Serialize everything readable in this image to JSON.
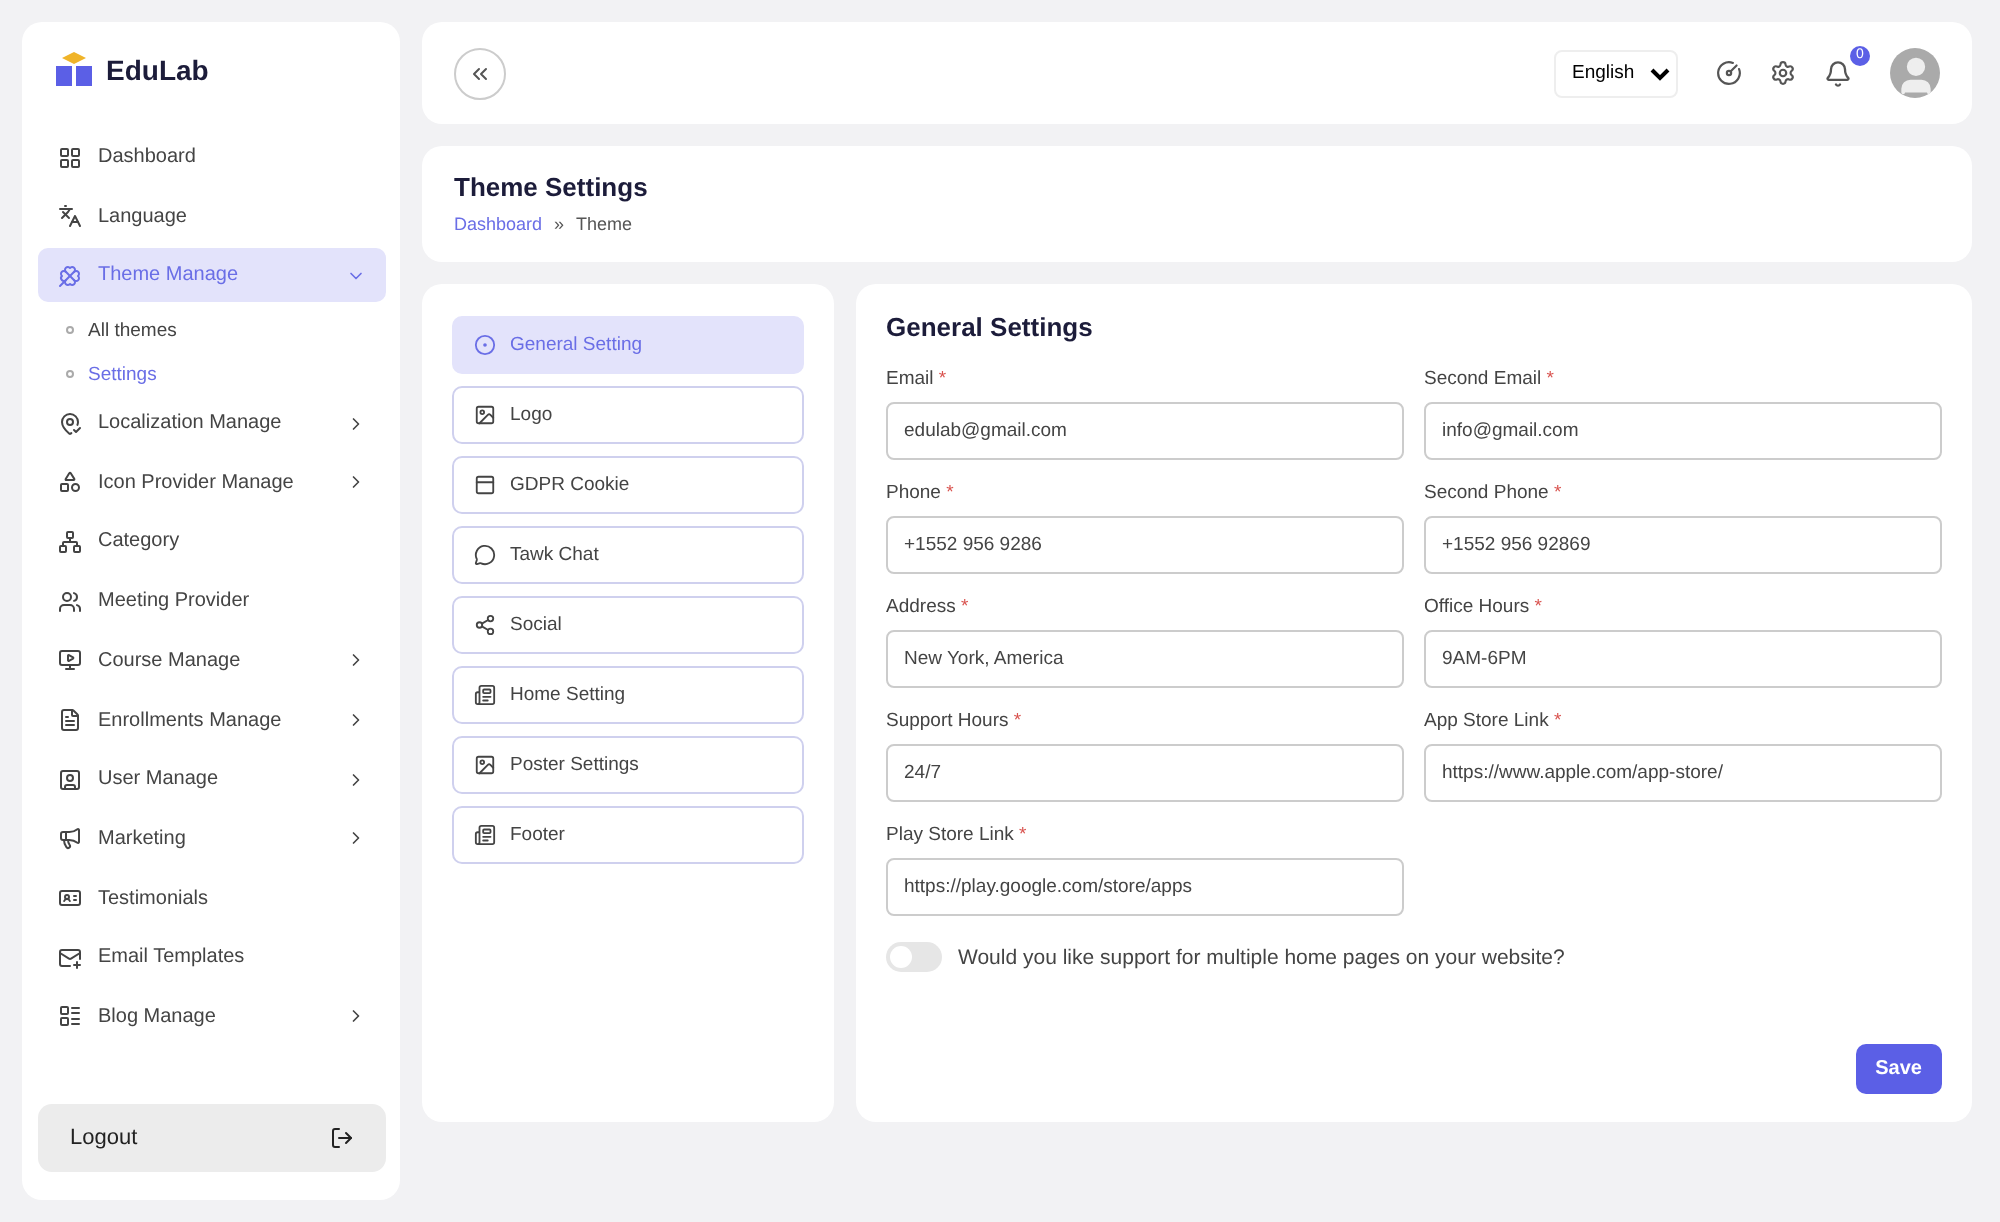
{
  "brand": {
    "name": "EduLab"
  },
  "sidebar": {
    "items": [
      {
        "label": "Dashboard",
        "kind": "link",
        "selected": false
      },
      {
        "label": "Language",
        "kind": "link",
        "selected": false
      },
      {
        "label": "Theme Manage",
        "kind": "group",
        "selected": true,
        "expanded": true,
        "children": [
          {
            "label": "All themes",
            "selected": false
          },
          {
            "label": "Settings",
            "selected": true
          }
        ]
      },
      {
        "label": "Localization Manage",
        "kind": "group",
        "selected": false,
        "expanded": false
      },
      {
        "label": "Icon Provider Manage",
        "kind": "group",
        "selected": false,
        "expanded": false
      },
      {
        "label": "Category",
        "kind": "link",
        "selected": false
      },
      {
        "label": "Meeting Provider",
        "kind": "link",
        "selected": false
      },
      {
        "label": "Course Manage",
        "kind": "group",
        "selected": false,
        "expanded": false
      },
      {
        "label": "Enrollments Manage",
        "kind": "group",
        "selected": false,
        "expanded": false
      },
      {
        "label": "User Manage",
        "kind": "group",
        "selected": false,
        "expanded": false
      },
      {
        "label": "Marketing",
        "kind": "group",
        "selected": false,
        "expanded": false
      },
      {
        "label": "Testimonials",
        "kind": "link",
        "selected": false
      },
      {
        "label": "Email Templates",
        "kind": "link",
        "selected": false
      },
      {
        "label": "Blog Manage",
        "kind": "group",
        "selected": false,
        "expanded": false
      }
    ],
    "logout": "Logout"
  },
  "topbar": {
    "language": "English",
    "notifications": "0"
  },
  "header": {
    "title": "Theme Settings",
    "breadcrumb": [
      "Dashboard",
      "Theme"
    ],
    "separator": "»"
  },
  "setting_tabs": [
    {
      "label": "General Setting",
      "selected": true
    },
    {
      "label": "Logo",
      "selected": false
    },
    {
      "label": "GDPR Cookie",
      "selected": false
    },
    {
      "label": "Tawk Chat",
      "selected": false
    },
    {
      "label": "Social",
      "selected": false
    },
    {
      "label": "Home Setting",
      "selected": false
    },
    {
      "label": "Poster Settings",
      "selected": false
    },
    {
      "label": "Footer",
      "selected": false
    }
  ],
  "form": {
    "title": "General Settings",
    "required_mark": "*",
    "fields": [
      {
        "label": "Email",
        "required": true,
        "value": "edulab@gmail.com"
      },
      {
        "label": "Second Email",
        "required": true,
        "value": "info@gmail.com"
      },
      {
        "label": "Phone",
        "required": true,
        "value": "+1552 956 9286"
      },
      {
        "label": "Second Phone",
        "required": true,
        "value": "+1552 956 92869"
      },
      {
        "label": "Address",
        "required": true,
        "value": "New York, America"
      },
      {
        "label": "Office Hours",
        "required": true,
        "value": "9AM-6PM"
      },
      {
        "label": "Support Hours",
        "required": true,
        "value": "24/7"
      },
      {
        "label": "App Store Link",
        "required": true,
        "value": "https://www.apple.com/app-store/"
      },
      {
        "label": "Play Store Link",
        "required": true,
        "value": "https://play.google.com/store/apps"
      }
    ],
    "toggle": {
      "label": "Would you like support for multiple home pages on your website?",
      "on": false
    },
    "save": "Save"
  }
}
